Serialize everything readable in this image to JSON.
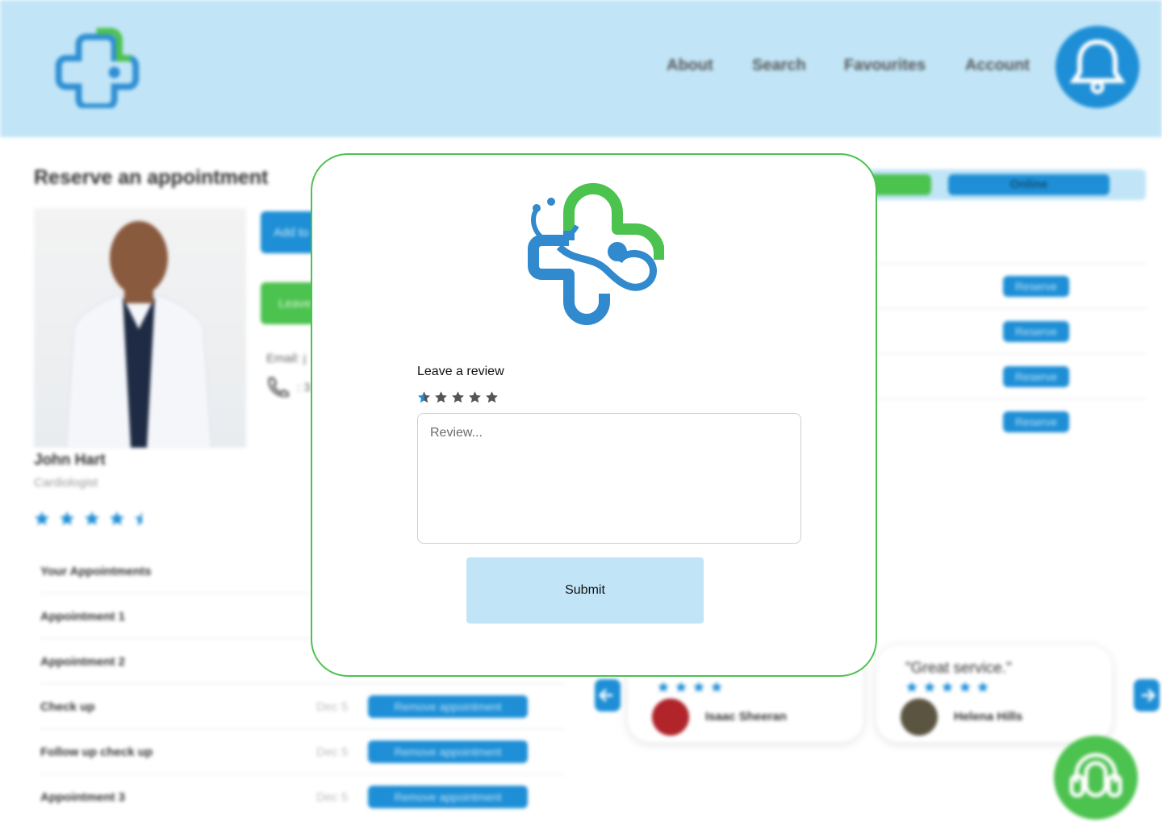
{
  "nav": {
    "items": [
      "About",
      "Search",
      "Favourites",
      "Account"
    ]
  },
  "page": {
    "title": "Reserve an appointment",
    "add_button": "Add to",
    "leave_button": "Leave",
    "email_label": "Email: j",
    "phone_label": ": 3"
  },
  "doctor": {
    "name": "John Hart",
    "specialty": "Cardiologist",
    "rating": 4.5
  },
  "appointments": {
    "header": "Your Appointments",
    "rows": [
      {
        "label": "Appointment 1",
        "date": "",
        "action": ""
      },
      {
        "label": "Appointment 2",
        "date": "",
        "action": ""
      },
      {
        "label": "Check up",
        "date": "Dec 5",
        "action": "Remove appointment"
      },
      {
        "label": "Follow up check up",
        "date": "Dec 5",
        "action": "Remove appointment"
      },
      {
        "label": "Appointment 3",
        "date": "Dec 5",
        "action": "Remove appointment"
      }
    ]
  },
  "visit_type": {
    "online": "Online"
  },
  "slots": {
    "reserve_label": "Reserve"
  },
  "reviews": [
    {
      "quote": "",
      "rating": 4,
      "author": "Isaac Sheeran"
    },
    {
      "quote": "\"Great service.\"",
      "rating": 5,
      "author": "Helena Hills"
    }
  ],
  "modal": {
    "heading": "Leave a review",
    "rating_max": 5,
    "rating_value": 0.5,
    "placeholder": "Review...",
    "submit_label": "Submit"
  },
  "colors": {
    "header_bg": "#c1e5f7",
    "brand_blue": "#1e8fd6",
    "brand_green": "#4cc24f",
    "star_gray": "#555555"
  },
  "icons": [
    "medical-cross-logo",
    "bell-icon",
    "phone-icon",
    "star-icon",
    "arrow-left-icon",
    "arrow-right-icon",
    "headset-support-icon"
  ]
}
